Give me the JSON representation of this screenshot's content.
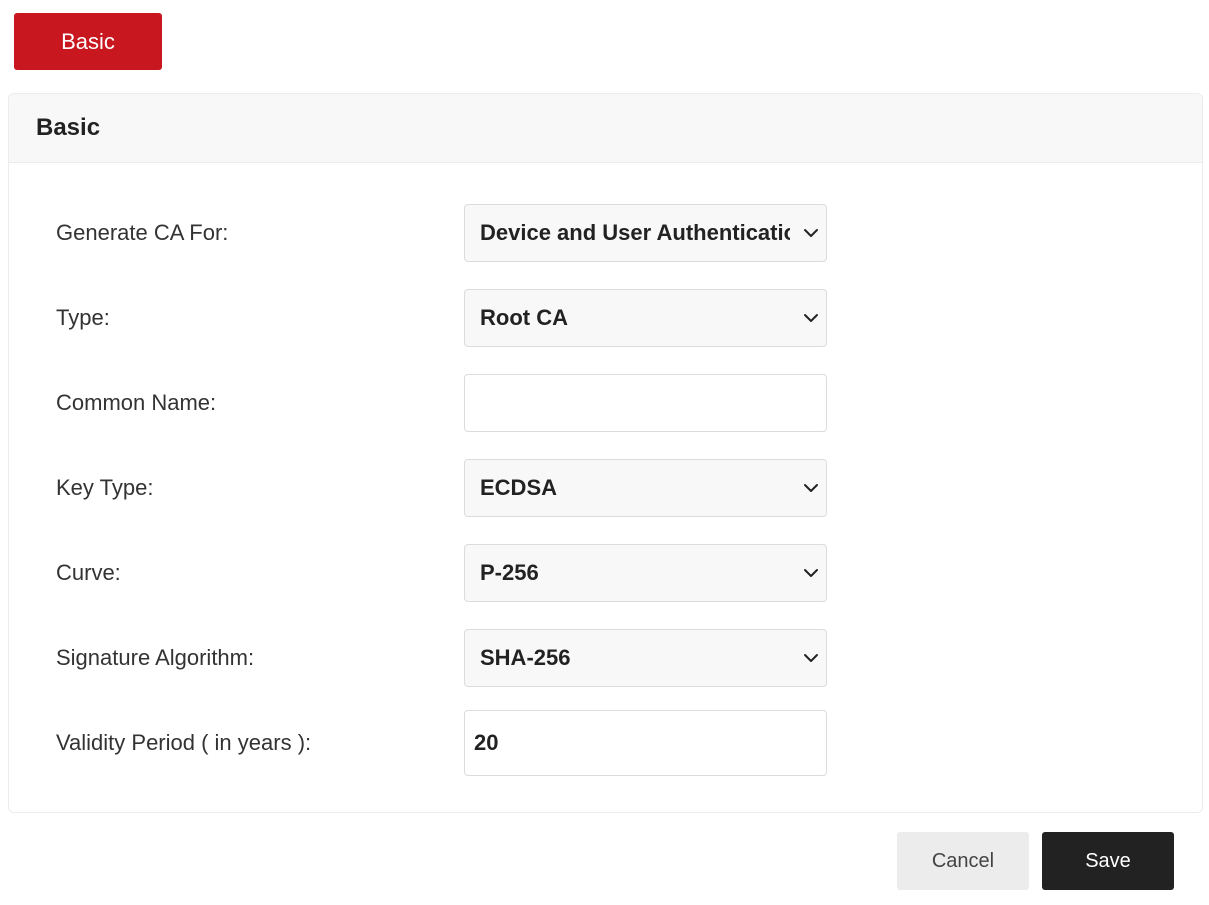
{
  "tab": {
    "label": "Basic"
  },
  "panel": {
    "title": "Basic"
  },
  "form": {
    "generate_ca_for": {
      "label": "Generate CA For:",
      "value": "Device and User Authentication"
    },
    "type": {
      "label": "Type:",
      "value": "Root CA"
    },
    "common_name": {
      "label": "Common Name:",
      "value": "",
      "placeholder": ""
    },
    "key_type": {
      "label": "Key Type:",
      "value": "ECDSA"
    },
    "curve": {
      "label": "Curve:",
      "value": "P-256"
    },
    "signature_algorithm": {
      "label": "Signature Algorithm:",
      "value": "SHA-256"
    },
    "validity_period": {
      "label": "Validity Period ( in years ):",
      "value": "20"
    }
  },
  "actions": {
    "cancel_label": "Cancel",
    "save_label": "Save"
  },
  "icons": {
    "select": "chevron-down-icon"
  },
  "colors": {
    "accent": "#c8171e",
    "save_bg": "#222222",
    "cancel_bg": "#ececec"
  }
}
